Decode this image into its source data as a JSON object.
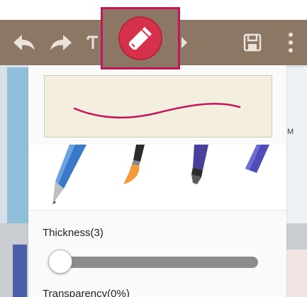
{
  "toolbar": {
    "icons": [
      "undo-icon",
      "redo-icon",
      "text-icon",
      "pen-icon",
      "chevron-right-icon",
      "save-icon",
      "more-vert-icon"
    ]
  },
  "backdrop": {
    "letter": "M"
  },
  "pen_panel": {
    "thickness_label": "Thickness(3)",
    "thickness_value": 3,
    "transparency_label": "Transparency(0%)",
    "pen_color": "#c2185b",
    "pen_types": [
      "ballpoint-pen-icon",
      "brush-icon",
      "marker-icon",
      "highlighter-icon"
    ]
  },
  "colors": {
    "toolbar": "#8c7765",
    "accent": "#c2185b",
    "pen_button": "#d6314a"
  }
}
